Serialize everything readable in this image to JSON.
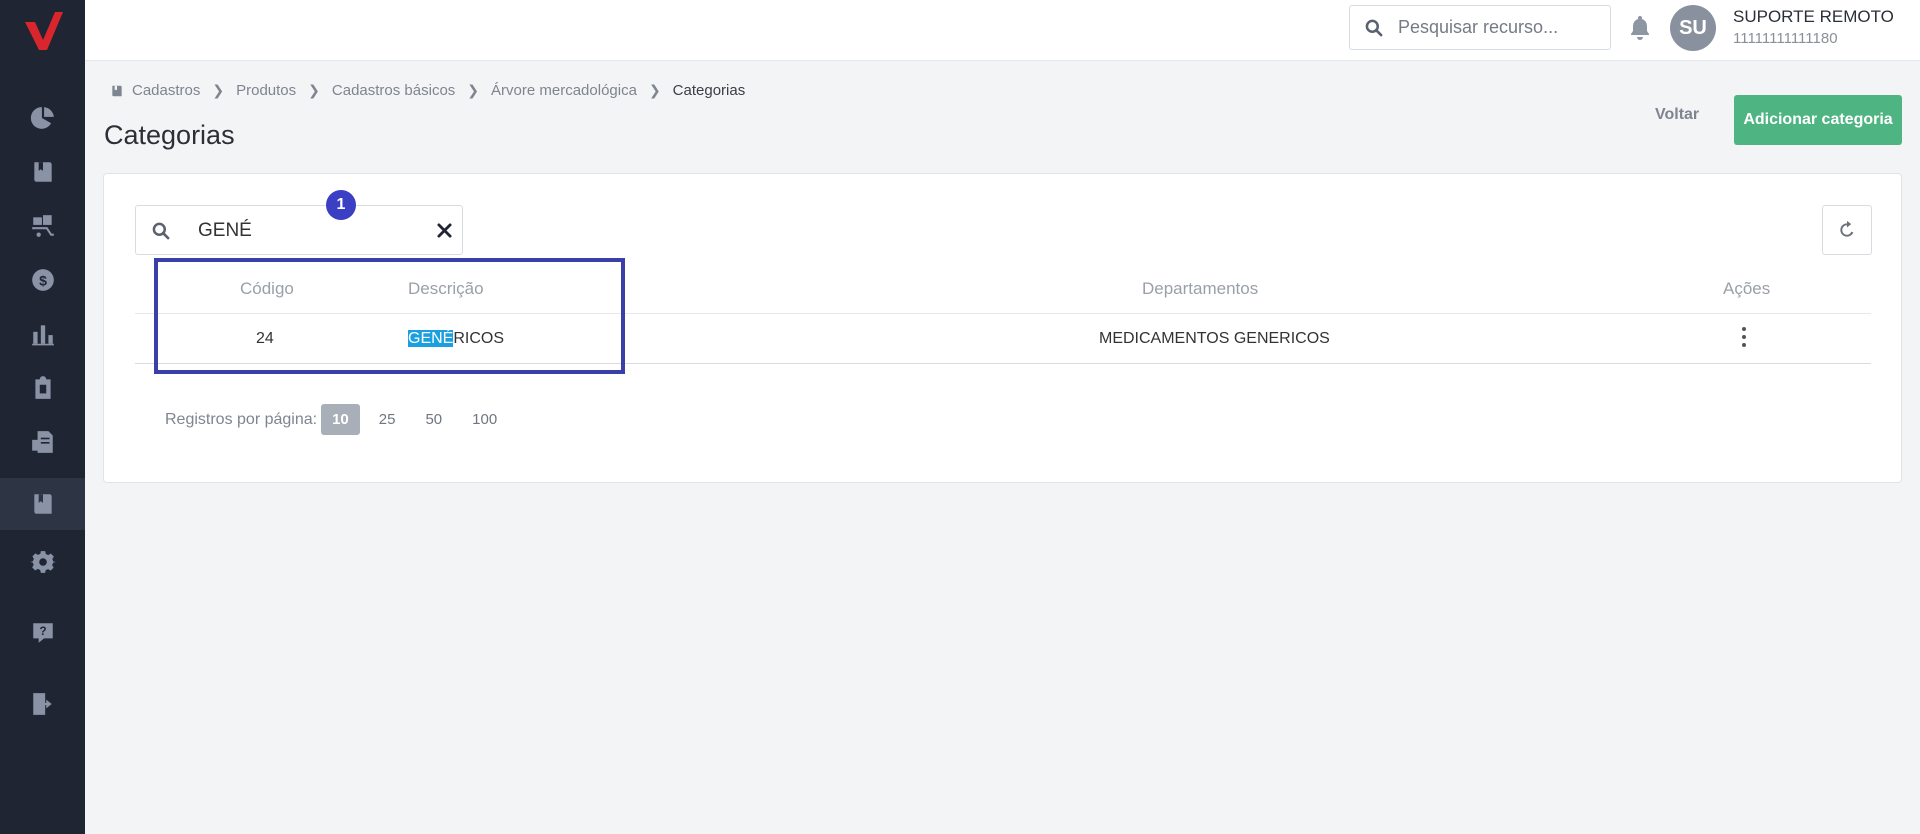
{
  "topbar": {
    "search_placeholder": "Pesquisar recurso...",
    "user_initials": "SU",
    "user_name": "SUPORTE REMOTO",
    "user_id": "11111111111180"
  },
  "sidebar": {
    "items": [
      {
        "icon": "pie-chart-icon"
      },
      {
        "icon": "book-icon"
      },
      {
        "icon": "dolly-boxes-icon"
      },
      {
        "icon": "dollar-coin-icon"
      },
      {
        "icon": "bar-chart-icon"
      },
      {
        "icon": "clipboard-icon"
      },
      {
        "icon": "file-invoice-icon"
      },
      {
        "icon": "book-icon",
        "active": true
      },
      {
        "icon": "gear-icon"
      },
      {
        "icon": "help-icon"
      },
      {
        "icon": "logout-icon"
      }
    ]
  },
  "breadcrumb": [
    "Cadastros",
    "Produtos",
    "Cadastros básicos",
    "Árvore mercadológica",
    "Categorias"
  ],
  "page_title": "Categorias",
  "actions": {
    "back_label": "Voltar",
    "add_label": "Adicionar categoria"
  },
  "filter": {
    "value": "GENÉ",
    "badge": "1"
  },
  "table": {
    "headers": {
      "code": "Código",
      "description": "Descrição",
      "departments": "Departamentos",
      "actions": "Ações"
    },
    "rows": [
      {
        "code": "24",
        "description_match": "GENÉ",
        "description_rest": "RICOS",
        "departments": "MEDICAMENTOS GENERICOS"
      }
    ]
  },
  "pagination": {
    "label": "Registros por página:",
    "options": [
      "10",
      "25",
      "50",
      "100"
    ],
    "selected": "10"
  },
  "colors": {
    "accent_green": "#4eb481",
    "sidebar_bg": "#1f2532",
    "highlight": "#1a9fe0",
    "annotation": "#3b3fa8"
  }
}
